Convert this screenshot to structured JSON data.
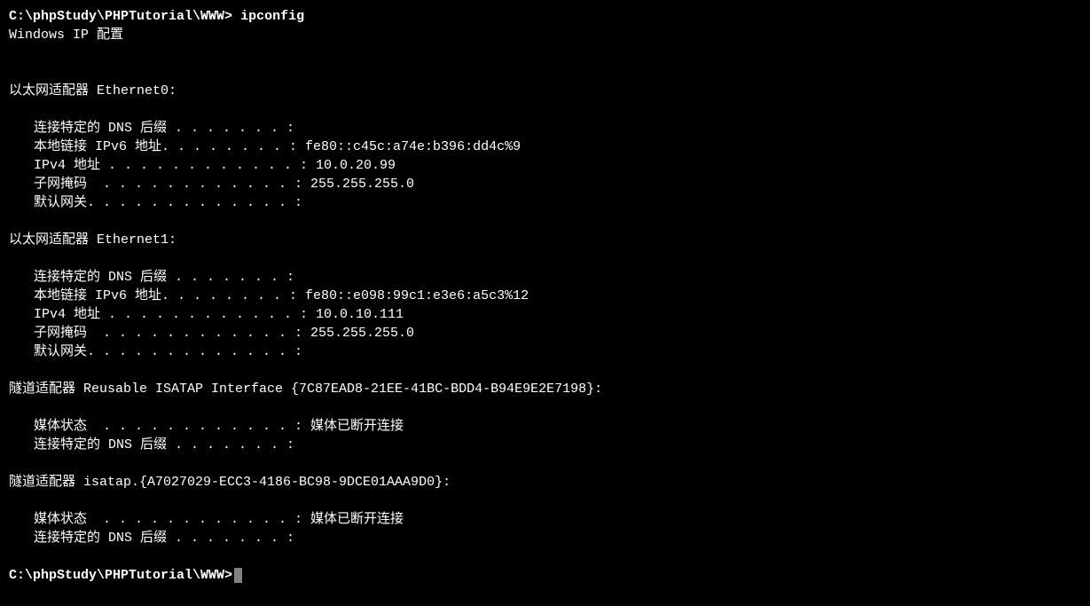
{
  "prompt1": "C:\\phpStudy\\PHPTutorial\\WWW>",
  "command": "ipconfig",
  "header": "Windows IP 配置",
  "adapters": [
    {
      "title": "以太网适配器 Ethernet0:",
      "lines": [
        "连接特定的 DNS 后缀 . . . . . . . :",
        "本地链接 IPv6 地址. . . . . . . . : fe80::c45c:a74e:b396:dd4c%9",
        "IPv4 地址 . . . . . . . . . . . . : 10.0.20.99",
        "子网掩码  . . . . . . . . . . . . : 255.255.255.0",
        "默认网关. . . . . . . . . . . . . :"
      ]
    },
    {
      "title": "以太网适配器 Ethernet1:",
      "lines": [
        "连接特定的 DNS 后缀 . . . . . . . :",
        "本地链接 IPv6 地址. . . . . . . . : fe80::e098:99c1:e3e6:a5c3%12",
        "IPv4 地址 . . . . . . . . . . . . : 10.0.10.111",
        "子网掩码  . . . . . . . . . . . . : 255.255.255.0",
        "默认网关. . . . . . . . . . . . . :"
      ]
    },
    {
      "title": "隧道适配器 Reusable ISATAP Interface {7C87EAD8-21EE-41BC-BDD4-B94E9E2E7198}:",
      "lines": [
        "媒体状态  . . . . . . . . . . . . : 媒体已断开连接",
        "连接特定的 DNS 后缀 . . . . . . . :"
      ]
    },
    {
      "title": "隧道适配器 isatap.{A7027029-ECC3-4186-BC98-9DCE01AAA9D0}:",
      "lines": [
        "媒体状态  . . . . . . . . . . . . : 媒体已断开连接",
        "连接特定的 DNS 后缀 . . . . . . . :"
      ]
    }
  ],
  "prompt2": "C:\\phpStudy\\PHPTutorial\\WWW>"
}
